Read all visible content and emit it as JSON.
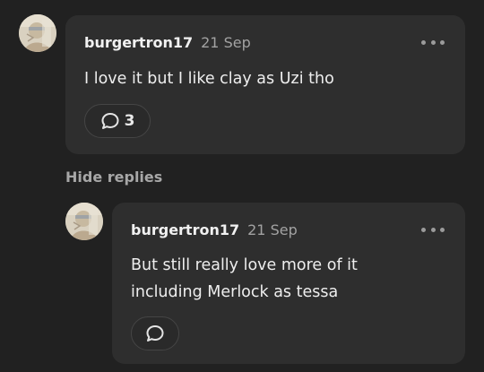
{
  "comment": {
    "username": "burgertron17",
    "date": "21 Sep",
    "text": "I love it but I like clay as Uzi tho",
    "reply_count": "3"
  },
  "hide_replies_label": "Hide replies",
  "reply": {
    "username": "burgertron17",
    "date": "21 Sep",
    "text_lines": [
      "But still really love more of it",
      "including Merlock as tessa"
    ]
  },
  "colors": {
    "background": "#212121",
    "card": "#2e2e2e",
    "muted_text": "#a2a2a2"
  },
  "icons": {
    "more": "more-horizontal-icon",
    "reply": "speech-bubble-icon"
  }
}
